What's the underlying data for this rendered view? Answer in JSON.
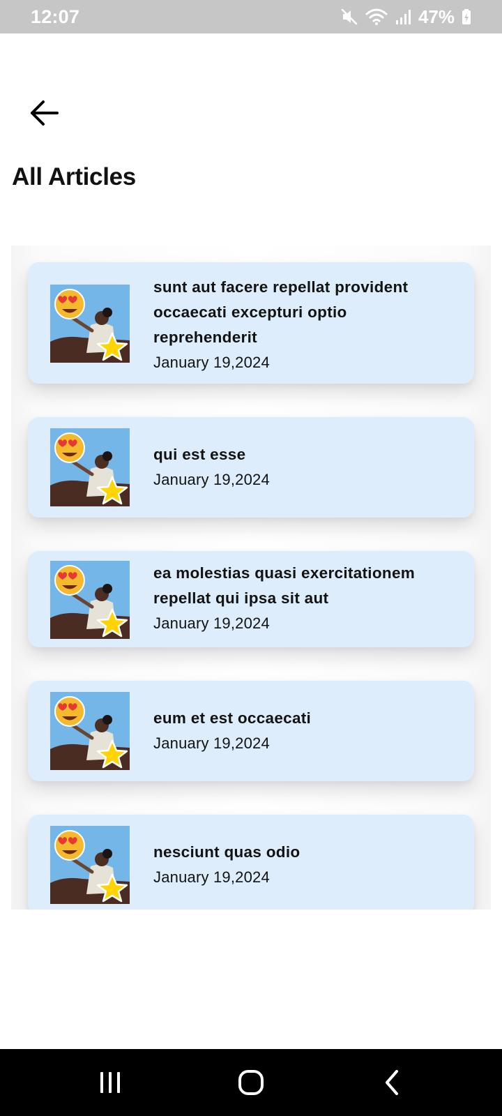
{
  "status_bar": {
    "time": "12:07",
    "battery": "47%",
    "icons": [
      "mute-icon",
      "wifi-icon",
      "signal-icon",
      "battery-icon"
    ]
  },
  "header": {
    "back_icon": "arrow-left-icon",
    "title": "All Articles"
  },
  "colors": {
    "card_background": "#deedfb",
    "thumb_background": "#74b6e8",
    "status_bar": "#c6c6c6",
    "nav_bar": "#000000"
  },
  "articles": [
    {
      "title": "sunt aut facere repellat provident occaecati excepturi optio reprehenderit",
      "date": "January 19,2024",
      "thumbnail": "emoji-star-person-image"
    },
    {
      "title": "qui est esse",
      "date": "January 19,2024",
      "thumbnail": "emoji-star-person-image"
    },
    {
      "title": "ea molestias quasi exercitationem repellat qui ipsa sit aut",
      "date": "January 19,2024",
      "thumbnail": "emoji-star-person-image"
    },
    {
      "title": "eum et est occaecati",
      "date": "January 19,2024",
      "thumbnail": "emoji-star-person-image"
    },
    {
      "title": "nesciunt quas odio",
      "date": "January 19,2024",
      "thumbnail": "emoji-star-person-image"
    }
  ],
  "nav_bar": {
    "icons": [
      "recent-apps-icon",
      "home-icon",
      "back-icon"
    ]
  }
}
